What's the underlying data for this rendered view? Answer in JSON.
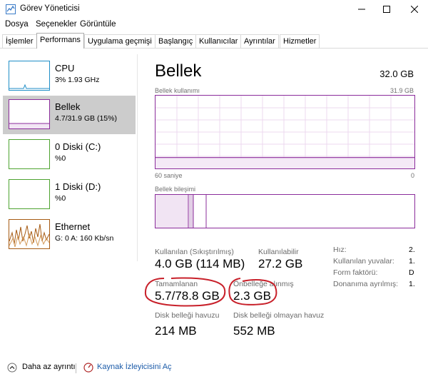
{
  "window": {
    "title": "Görev Yöneticisi"
  },
  "menu": [
    "Dosya",
    "Seçenekler",
    "Görüntüle"
  ],
  "tabs": [
    "İşlemler",
    "Performans",
    "Uygulama geçmişi",
    "Başlangıç",
    "Kullanıcılar",
    "Ayrıntılar",
    "Hizmetler"
  ],
  "sidebar": [
    {
      "title": "CPU",
      "sub": "3% 1.93 GHz",
      "color": "#1f8ec7"
    },
    {
      "title": "Bellek",
      "sub": "4.7/31.9 GB (15%)",
      "color": "#8b2c9b"
    },
    {
      "title": "0 Diski (C:)",
      "sub": "%0",
      "color": "#4da32f"
    },
    {
      "title": "1 Diski (D:)",
      "sub": "%0",
      "color": "#4da32f"
    },
    {
      "title": "Ethernet",
      "sub": "G: 0 A: 160 Kb/sn",
      "color": "#a65a13"
    }
  ],
  "memory": {
    "title": "Bellek",
    "total": "32.0 GB",
    "usage_label": "Bellek kullanımı",
    "usage_max": "31.9 GB",
    "axis_left": "60 saniye",
    "axis_right": "0",
    "usage_level": 0.15,
    "composition_label": "Bellek bileşimi",
    "stats": {
      "in_use_label": "Kullanılan (Sıkıştırılmış)",
      "in_use_value": "4.0 GB (114 MB)",
      "available_label": "Kullanılabilir",
      "available_value": "27.2 GB",
      "committed_label": "Tamamlanan",
      "committed_value": "5.7/78.8 GB",
      "cached_label": "Önbelleğe alınmış",
      "cached_value": "2.3 GB",
      "paged_pool_label": "Disk belleği havuzu",
      "paged_pool_value": "214 MB",
      "nonpaged_pool_label": "Disk belleği olmayan havuz",
      "nonpaged_pool_value": "552 MB"
    },
    "details": [
      {
        "label": "Hız:",
        "value": "2."
      },
      {
        "label": "Kullanılan yuvalar:",
        "value": "1."
      },
      {
        "label": "Form faktörü:",
        "value": "D"
      },
      {
        "label": "Donanıma ayrılmış:",
        "value": "1."
      }
    ]
  },
  "footer": {
    "fewer_details": "Daha az ayrıntı",
    "resource_monitor": "Kaynak İzleyicisini Aç"
  },
  "annotation_color": "#c8202a"
}
